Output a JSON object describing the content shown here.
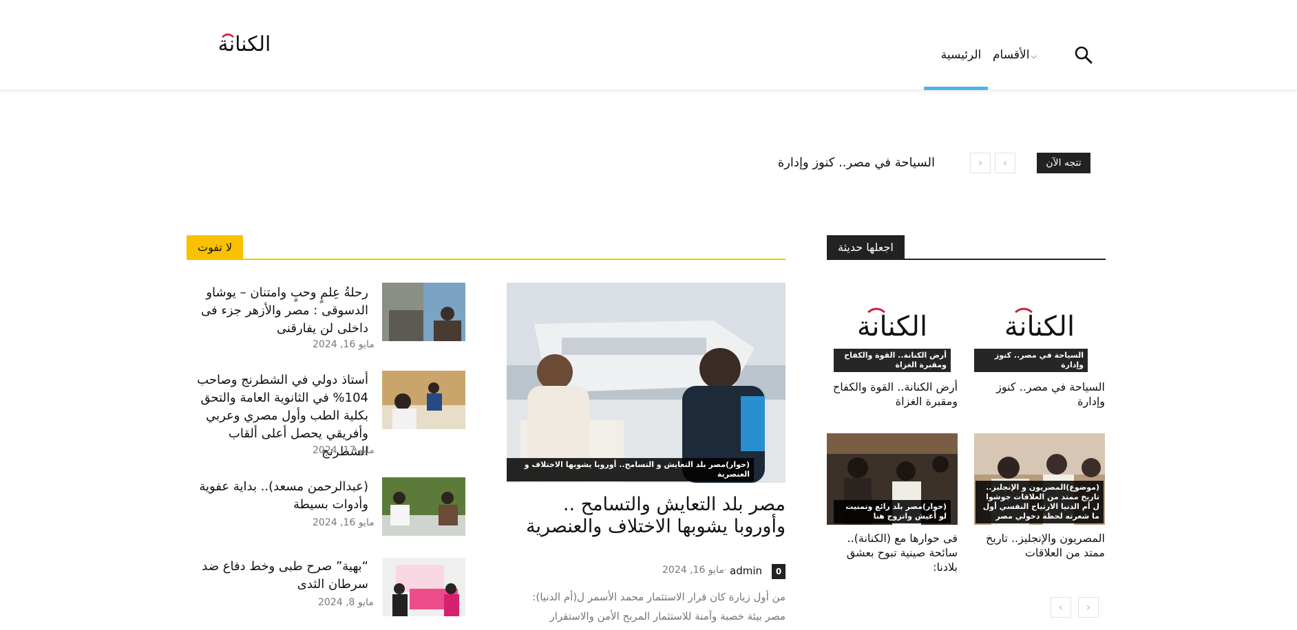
{
  "header": {
    "logo_text": "الكنانة",
    "nav": {
      "home": "الرئيسية",
      "sections": "الأقسام"
    }
  },
  "ticker": {
    "badge": "تتجه الآن",
    "headline": "السياحة في مصر.. كنوز وإدارة"
  },
  "dont_miss": {
    "title": "لا تفوت",
    "main_post": {
      "image_caption": "(حوار)مصر بلد التعايش و التسامح.. أوروبا يشوبها الاختلاف و العنصرية",
      "title": "مصر بلد التعايش والتسامح .. وأوروبا يشوبها الاختلاف والعنصرية",
      "comments": "0",
      "author": "admin",
      "date": "مايو 16, 2024",
      "excerpt": "من أول زيارة كان قرار الاستثمار محمد الأسمر ل(أم الدنيا): مصر بيئة خصبة وآمنة للاستثمار المربح الأمن والاستقرار"
    },
    "side_posts": [
      {
        "title": "رحلةُ عِلمٍ وحبٍ وامتنان – يوشاو الدسوقى : مصر والأزهر جزء فى داخلى لن يفارقنى",
        "date": "مايو 16, 2024"
      },
      {
        "title": "أستاذ دولي في الشطرنج وصاحب 104% في الثانوية العامة والتحق بكلية الطب وأول مصري وعربي وأفريقي يحصل أعلى ألقاب الشطرنج",
        "date": "مايو 17, 2024"
      },
      {
        "title": "(عبدالرحمن مسعد).. بداية عفوية وأدوات بسيطة",
        "date": "مايو 16, 2024"
      },
      {
        "title": "“بهية” صرح طبى وخط دفاع ضد سرطان الثدى",
        "date": "مايو 8, 2024"
      }
    ]
  },
  "latest": {
    "title": "اجعلها حديثة",
    "posts": [
      {
        "caption": "السياحة في مصر.. كنوز وإدارة",
        "title": "السياحة في مصر.. كنوز وإدارة"
      },
      {
        "caption": "أرض الكنانة.. القوة والكفاح ومقبرة الغزاة",
        "title": "أرض الكنانة.. القوة والكفاح ومقبرة الغزاة"
      },
      {
        "caption": "(موضوع)المصريون و الإنجليز.. تاريخ ممتد من العلاقات جوشوا ل أم الدنيا الارتياح النفسي أول ما شعرته لحظة دخولي مصر",
        "title": "المصريون والإنجليز.. تاريخ ممتد من العلاقات"
      },
      {
        "caption": "(حوار)مصر بلد رائع وتمنيت لو أعيش واتزوج هنا",
        "title": "فى حوارها مع (الكنانة).. سائحة صينية تبوح بعشق بلادنا:"
      }
    ]
  },
  "colors": {
    "accent_blue": "#4db2ec",
    "dont_miss_yellow": "#f9c100",
    "dark": "#222222"
  }
}
